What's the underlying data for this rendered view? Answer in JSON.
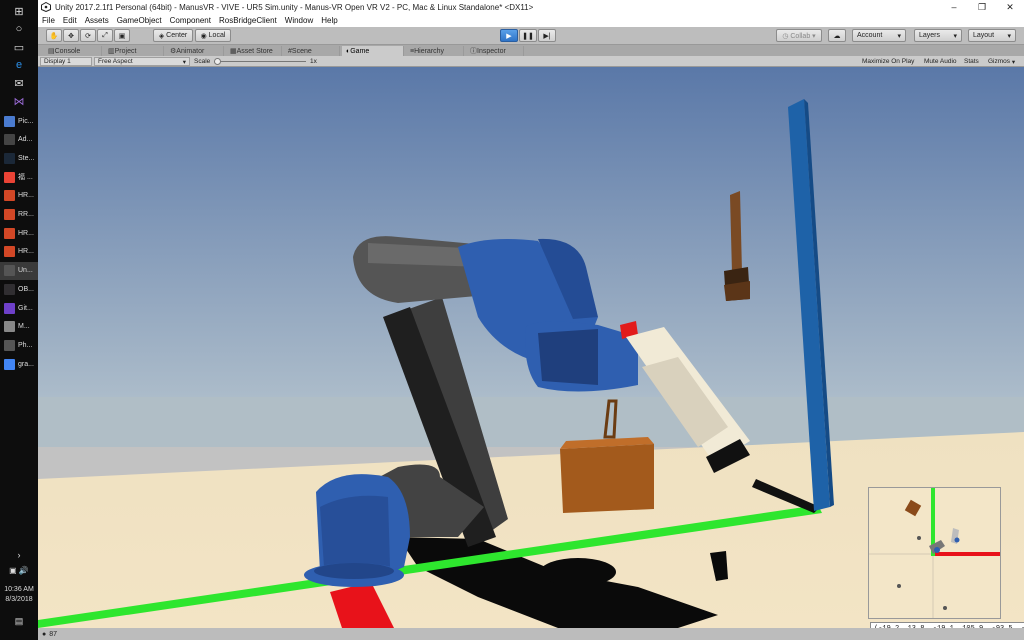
{
  "taskbar": {
    "apps": [
      {
        "label": "Pic...",
        "color": "#4a7bd0",
        "active": false
      },
      {
        "label": "Ad...",
        "color": "#444444",
        "active": false
      },
      {
        "label": "Ste...",
        "color": "#1b2838",
        "active": false
      },
      {
        "label": "福 ...",
        "color": "#ea4335",
        "active": false
      },
      {
        "label": "HR...",
        "color": "#d24726",
        "active": false
      },
      {
        "label": "RR...",
        "color": "#d24726",
        "active": false
      },
      {
        "label": "HR...",
        "color": "#d24726",
        "active": false
      },
      {
        "label": "HR...",
        "color": "#d24726",
        "active": false
      },
      {
        "label": "Un...",
        "color": "#555555",
        "active": true
      },
      {
        "label": "OB...",
        "color": "#302e31",
        "active": false
      },
      {
        "label": "Git...",
        "color": "#6e40c9",
        "active": false
      },
      {
        "label": "M...",
        "color": "#888888",
        "active": false
      },
      {
        "label": "Ph...",
        "color": "#555555",
        "active": false
      },
      {
        "label": "gra...",
        "color": "#4285f4",
        "active": false
      }
    ],
    "time": "10:36 AM",
    "date": "8/3/2018"
  },
  "window": {
    "title": "Unity 2017.2.1f1 Personal (64bit) - ManusVR - VIVE - UR5 Sim.unity - Manus-VR Open VR V2 - PC, Mac & Linux Standalone* <DX11>",
    "controls": {
      "minimize": "–",
      "restore": "❐",
      "close": "✕"
    }
  },
  "menu": [
    "File",
    "Edit",
    "Assets",
    "GameObject",
    "Component",
    "RosBridgeClient",
    "Window",
    "Help"
  ],
  "toolbar": {
    "pivot": "Center",
    "space": "Local",
    "collab": "Collab ▾",
    "account": "Account",
    "layers": "Layers",
    "layout": "Layout"
  },
  "tabs": [
    {
      "label": "Console",
      "active": false
    },
    {
      "label": "Project",
      "active": false
    },
    {
      "label": "Animator",
      "active": false
    },
    {
      "label": "Asset Store",
      "active": false
    },
    {
      "label": "Scene",
      "active": false
    },
    {
      "label": "Game",
      "active": true
    },
    {
      "label": "Hierarchy",
      "active": false
    },
    {
      "label": "Inspector",
      "active": false
    }
  ],
  "gamebar": {
    "display": "Display 1",
    "aspect": "Free Aspect",
    "scale_label": "Scale",
    "scale_value": "1x",
    "maximize": "Maximize On Play",
    "mute": "Mute Audio",
    "stats": "Stats",
    "gizmos": "Gizmos"
  },
  "minimap": {
    "coords": "(-19.2, 13.8, -19.1, 105.9, -93.5, -16"
  },
  "status": {
    "text": "87"
  },
  "colors": {
    "sky_top": "#5a78a8",
    "sky_bottom": "#b8c6cf",
    "floor": "#efe1c1",
    "robot_blue": "#2f5fb0",
    "robot_gray": "#4a4a4a",
    "axis_green": "#2ee62e",
    "axis_red": "#e8121a",
    "pole_blue": "#1e62a8",
    "box_brown": "#a35a1c"
  }
}
